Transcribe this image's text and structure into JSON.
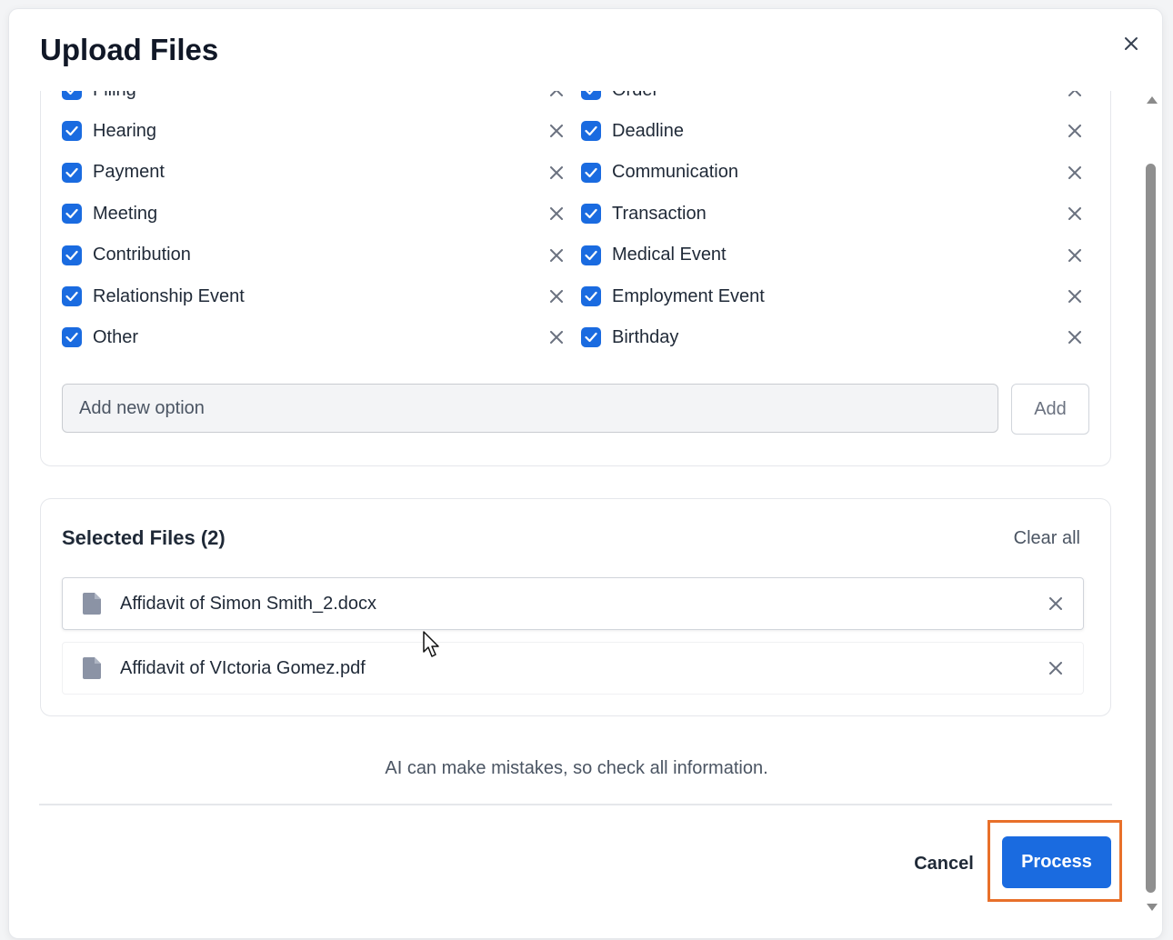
{
  "modal": {
    "title": "Upload Files"
  },
  "options": {
    "left": [
      {
        "label": "Filing",
        "checked": true
      },
      {
        "label": "Hearing",
        "checked": true
      },
      {
        "label": "Payment",
        "checked": true
      },
      {
        "label": "Meeting",
        "checked": true
      },
      {
        "label": "Contribution",
        "checked": true
      },
      {
        "label": "Relationship Event",
        "checked": true
      },
      {
        "label": "Other",
        "checked": true
      }
    ],
    "right": [
      {
        "label": "Order",
        "checked": true
      },
      {
        "label": "Deadline",
        "checked": true
      },
      {
        "label": "Communication",
        "checked": true
      },
      {
        "label": "Transaction",
        "checked": true
      },
      {
        "label": "Medical Event",
        "checked": true
      },
      {
        "label": "Employment Event",
        "checked": true
      },
      {
        "label": "Birthday",
        "checked": true
      }
    ],
    "new_option_placeholder": "Add new option",
    "new_option_value": "",
    "add_label": "Add"
  },
  "files": {
    "title": "Selected Files (2)",
    "clear_all_label": "Clear all",
    "items": [
      {
        "name": "Affidavit of Simon Smith_2.docx"
      },
      {
        "name": "Affidavit of VIctoria Gomez.pdf"
      }
    ]
  },
  "disclaimer": "AI can make mistakes, so check all information.",
  "footer": {
    "cancel_label": "Cancel",
    "process_label": "Process"
  },
  "colors": {
    "accent": "#1a6be0",
    "highlight": "#e8702a"
  },
  "icons": {
    "close": "close-icon",
    "check": "checkmark-icon",
    "remove": "x-icon",
    "file": "file-icon",
    "cursor": "mouse-pointer-icon"
  }
}
